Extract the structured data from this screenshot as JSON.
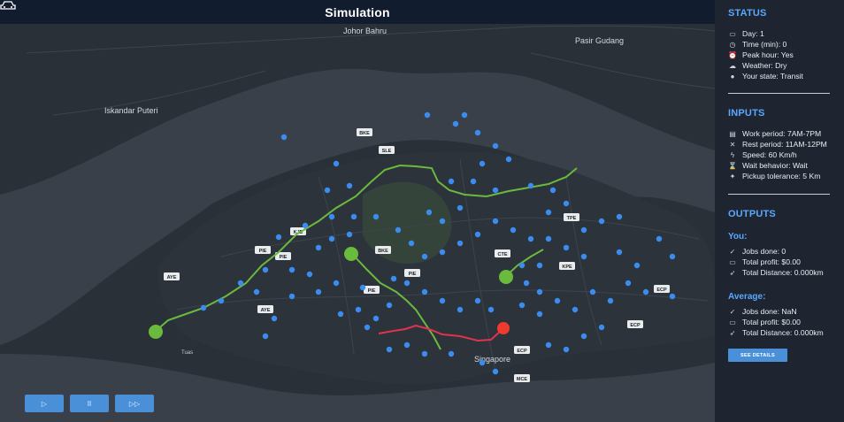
{
  "header": {
    "title": "Simulation",
    "icon": "car-icon"
  },
  "map": {
    "labels": [
      "Johor Bahru",
      "Iskandar Puteri",
      "Pasir Gudang",
      "Singapore",
      "Tuas"
    ],
    "road_badges": [
      "BKE",
      "SLE",
      "KJE",
      "PIE",
      "PIE",
      "PIE",
      "PIE",
      "BKE",
      "AYE",
      "AYE",
      "CTE",
      "KPE",
      "TPE",
      "ECP",
      "ECP",
      "ECP",
      "MCE"
    ],
    "route_colors": {
      "green": "#6aba3d",
      "red": "#e0334f",
      "points": "#3b8cf0",
      "agent": "#ef3b2d"
    }
  },
  "controls": {
    "play": "▷",
    "pause": "II",
    "forward": "▷▷"
  },
  "status": {
    "heading": "STATUS",
    "items": [
      {
        "icon": "calendar-icon",
        "glyph": "▭",
        "text": "Day: 1"
      },
      {
        "icon": "clock-icon",
        "glyph": "◷",
        "text": "Time (min): 0"
      },
      {
        "icon": "alarm-icon",
        "glyph": "⏰",
        "text": "Peak hour: Yes"
      },
      {
        "icon": "cloud-icon",
        "glyph": "☁",
        "text": "Weather: Dry"
      },
      {
        "icon": "user-icon",
        "glyph": "●",
        "text": "Your state: Transit"
      }
    ]
  },
  "inputs": {
    "heading": "INPUTS",
    "items": [
      {
        "icon": "briefcase-icon",
        "glyph": "▤",
        "text": "Work period: 7AM-7PM"
      },
      {
        "icon": "utensils-icon",
        "glyph": "✕",
        "text": "Rest period: 11AM-12PM"
      },
      {
        "icon": "bolt-icon",
        "glyph": "ϟ",
        "text": "Speed: 60 Km/h"
      },
      {
        "icon": "hourglass-icon",
        "glyph": "⌛",
        "text": "Wait behavior: Wait"
      },
      {
        "icon": "person-icon",
        "glyph": "✦",
        "text": "Pickup tolerance: 5 Km"
      }
    ]
  },
  "outputs": {
    "heading": "OUTPUTS",
    "you": {
      "label": "You:",
      "items": [
        {
          "icon": "check-icon",
          "glyph": "✓",
          "text": "Jobs done: 0"
        },
        {
          "icon": "wallet-icon",
          "glyph": "▭",
          "text": "Total profit: $0.00"
        },
        {
          "icon": "location-arrow-icon",
          "glyph": "➶",
          "text": "Total Distance: 0.000km"
        }
      ]
    },
    "average": {
      "label": "Average:",
      "items": [
        {
          "icon": "check-icon",
          "glyph": "✓",
          "text": "Jobs done: NaN"
        },
        {
          "icon": "wallet-icon",
          "glyph": "▭",
          "text": "Total profit: $0.00"
        },
        {
          "icon": "location-arrow-icon",
          "glyph": "➶",
          "text": "Total Distance: 0.000km"
        }
      ]
    },
    "details_button": "SEE DETAILS"
  }
}
